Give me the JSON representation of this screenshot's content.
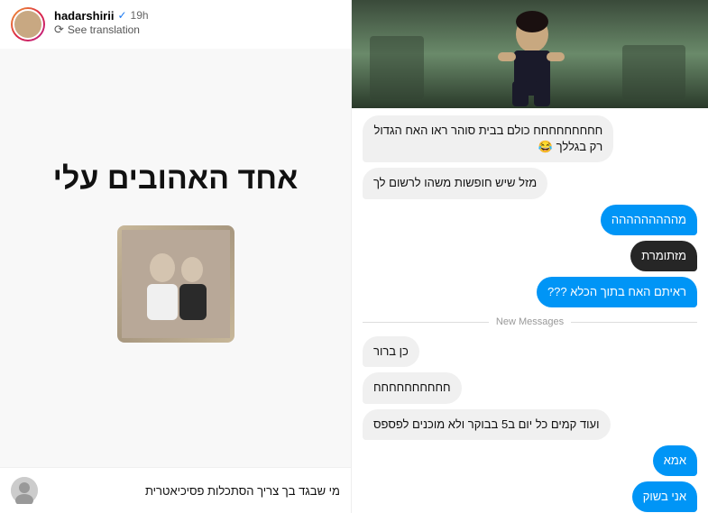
{
  "left": {
    "username": "hadarshirii",
    "verified": "✓",
    "time": "19h",
    "see_translation": "See translation",
    "big_text": "אחד האהובים עלי",
    "comment_text": "מי שבגד בך צריך הסתכלות פסיכיאטרית"
  },
  "right": {
    "messages": [
      {
        "id": 1,
        "text": "חחחחחחחחח כולם בבית סוהר ראו האח הגדול רק בגללך 😂",
        "type": "received"
      },
      {
        "id": 2,
        "text": "מזל שיש חופשות משהו לרשום לך",
        "type": "received"
      },
      {
        "id": 3,
        "text": "מההההההההה",
        "type": "sent"
      },
      {
        "id": 4,
        "text": "מזתומרת",
        "type": "sent-dark"
      },
      {
        "id": 5,
        "text": "ראיתם האח בתוך הכלא ???",
        "type": "sent"
      }
    ],
    "divider": "New Messages",
    "messages_after": [
      {
        "id": 6,
        "text": "כן ברור",
        "type": "received"
      },
      {
        "id": 7,
        "text": "חחחחחחחחחח",
        "type": "received"
      },
      {
        "id": 8,
        "text": "ועוד קמים כל יום ב5 בבוקר ולא מוכנים לפספס",
        "type": "received"
      },
      {
        "id": 9,
        "text": "אמא",
        "type": "sent"
      },
      {
        "id": 10,
        "text": "אני בשוק",
        "type": "sent"
      }
    ]
  }
}
